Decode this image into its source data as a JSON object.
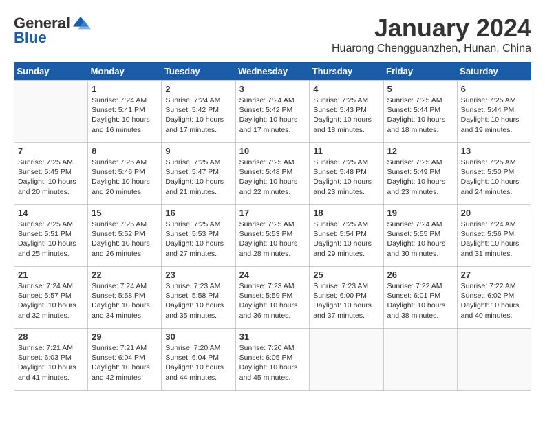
{
  "logo": {
    "general": "General",
    "blue": "Blue"
  },
  "title": "January 2024",
  "location": "Huarong Chengguanzhen, Hunan, China",
  "weekdays": [
    "Sunday",
    "Monday",
    "Tuesday",
    "Wednesday",
    "Thursday",
    "Friday",
    "Saturday"
  ],
  "weeks": [
    [
      {
        "day": "",
        "sunrise": "",
        "sunset": "",
        "daylight": ""
      },
      {
        "day": "1",
        "sunrise": "Sunrise: 7:24 AM",
        "sunset": "Sunset: 5:41 PM",
        "daylight": "Daylight: 10 hours and 16 minutes."
      },
      {
        "day": "2",
        "sunrise": "Sunrise: 7:24 AM",
        "sunset": "Sunset: 5:42 PM",
        "daylight": "Daylight: 10 hours and 17 minutes."
      },
      {
        "day": "3",
        "sunrise": "Sunrise: 7:24 AM",
        "sunset": "Sunset: 5:42 PM",
        "daylight": "Daylight: 10 hours and 17 minutes."
      },
      {
        "day": "4",
        "sunrise": "Sunrise: 7:25 AM",
        "sunset": "Sunset: 5:43 PM",
        "daylight": "Daylight: 10 hours and 18 minutes."
      },
      {
        "day": "5",
        "sunrise": "Sunrise: 7:25 AM",
        "sunset": "Sunset: 5:44 PM",
        "daylight": "Daylight: 10 hours and 18 minutes."
      },
      {
        "day": "6",
        "sunrise": "Sunrise: 7:25 AM",
        "sunset": "Sunset: 5:44 PM",
        "daylight": "Daylight: 10 hours and 19 minutes."
      }
    ],
    [
      {
        "day": "7",
        "sunrise": "Sunrise: 7:25 AM",
        "sunset": "Sunset: 5:45 PM",
        "daylight": "Daylight: 10 hours and 20 minutes."
      },
      {
        "day": "8",
        "sunrise": "Sunrise: 7:25 AM",
        "sunset": "Sunset: 5:46 PM",
        "daylight": "Daylight: 10 hours and 20 minutes."
      },
      {
        "day": "9",
        "sunrise": "Sunrise: 7:25 AM",
        "sunset": "Sunset: 5:47 PM",
        "daylight": "Daylight: 10 hours and 21 minutes."
      },
      {
        "day": "10",
        "sunrise": "Sunrise: 7:25 AM",
        "sunset": "Sunset: 5:48 PM",
        "daylight": "Daylight: 10 hours and 22 minutes."
      },
      {
        "day": "11",
        "sunrise": "Sunrise: 7:25 AM",
        "sunset": "Sunset: 5:48 PM",
        "daylight": "Daylight: 10 hours and 23 minutes."
      },
      {
        "day": "12",
        "sunrise": "Sunrise: 7:25 AM",
        "sunset": "Sunset: 5:49 PM",
        "daylight": "Daylight: 10 hours and 23 minutes."
      },
      {
        "day": "13",
        "sunrise": "Sunrise: 7:25 AM",
        "sunset": "Sunset: 5:50 PM",
        "daylight": "Daylight: 10 hours and 24 minutes."
      }
    ],
    [
      {
        "day": "14",
        "sunrise": "Sunrise: 7:25 AM",
        "sunset": "Sunset: 5:51 PM",
        "daylight": "Daylight: 10 hours and 25 minutes."
      },
      {
        "day": "15",
        "sunrise": "Sunrise: 7:25 AM",
        "sunset": "Sunset: 5:52 PM",
        "daylight": "Daylight: 10 hours and 26 minutes."
      },
      {
        "day": "16",
        "sunrise": "Sunrise: 7:25 AM",
        "sunset": "Sunset: 5:53 PM",
        "daylight": "Daylight: 10 hours and 27 minutes."
      },
      {
        "day": "17",
        "sunrise": "Sunrise: 7:25 AM",
        "sunset": "Sunset: 5:53 PM",
        "daylight": "Daylight: 10 hours and 28 minutes."
      },
      {
        "day": "18",
        "sunrise": "Sunrise: 7:25 AM",
        "sunset": "Sunset: 5:54 PM",
        "daylight": "Daylight: 10 hours and 29 minutes."
      },
      {
        "day": "19",
        "sunrise": "Sunrise: 7:24 AM",
        "sunset": "Sunset: 5:55 PM",
        "daylight": "Daylight: 10 hours and 30 minutes."
      },
      {
        "day": "20",
        "sunrise": "Sunrise: 7:24 AM",
        "sunset": "Sunset: 5:56 PM",
        "daylight": "Daylight: 10 hours and 31 minutes."
      }
    ],
    [
      {
        "day": "21",
        "sunrise": "Sunrise: 7:24 AM",
        "sunset": "Sunset: 5:57 PM",
        "daylight": "Daylight: 10 hours and 32 minutes."
      },
      {
        "day": "22",
        "sunrise": "Sunrise: 7:24 AM",
        "sunset": "Sunset: 5:58 PM",
        "daylight": "Daylight: 10 hours and 34 minutes."
      },
      {
        "day": "23",
        "sunrise": "Sunrise: 7:23 AM",
        "sunset": "Sunset: 5:58 PM",
        "daylight": "Daylight: 10 hours and 35 minutes."
      },
      {
        "day": "24",
        "sunrise": "Sunrise: 7:23 AM",
        "sunset": "Sunset: 5:59 PM",
        "daylight": "Daylight: 10 hours and 36 minutes."
      },
      {
        "day": "25",
        "sunrise": "Sunrise: 7:23 AM",
        "sunset": "Sunset: 6:00 PM",
        "daylight": "Daylight: 10 hours and 37 minutes."
      },
      {
        "day": "26",
        "sunrise": "Sunrise: 7:22 AM",
        "sunset": "Sunset: 6:01 PM",
        "daylight": "Daylight: 10 hours and 38 minutes."
      },
      {
        "day": "27",
        "sunrise": "Sunrise: 7:22 AM",
        "sunset": "Sunset: 6:02 PM",
        "daylight": "Daylight: 10 hours and 40 minutes."
      }
    ],
    [
      {
        "day": "28",
        "sunrise": "Sunrise: 7:21 AM",
        "sunset": "Sunset: 6:03 PM",
        "daylight": "Daylight: 10 hours and 41 minutes."
      },
      {
        "day": "29",
        "sunrise": "Sunrise: 7:21 AM",
        "sunset": "Sunset: 6:04 PM",
        "daylight": "Daylight: 10 hours and 42 minutes."
      },
      {
        "day": "30",
        "sunrise": "Sunrise: 7:20 AM",
        "sunset": "Sunset: 6:04 PM",
        "daylight": "Daylight: 10 hours and 44 minutes."
      },
      {
        "day": "31",
        "sunrise": "Sunrise: 7:20 AM",
        "sunset": "Sunset: 6:05 PM",
        "daylight": "Daylight: 10 hours and 45 minutes."
      },
      {
        "day": "",
        "sunrise": "",
        "sunset": "",
        "daylight": ""
      },
      {
        "day": "",
        "sunrise": "",
        "sunset": "",
        "daylight": ""
      },
      {
        "day": "",
        "sunrise": "",
        "sunset": "",
        "daylight": ""
      }
    ]
  ]
}
